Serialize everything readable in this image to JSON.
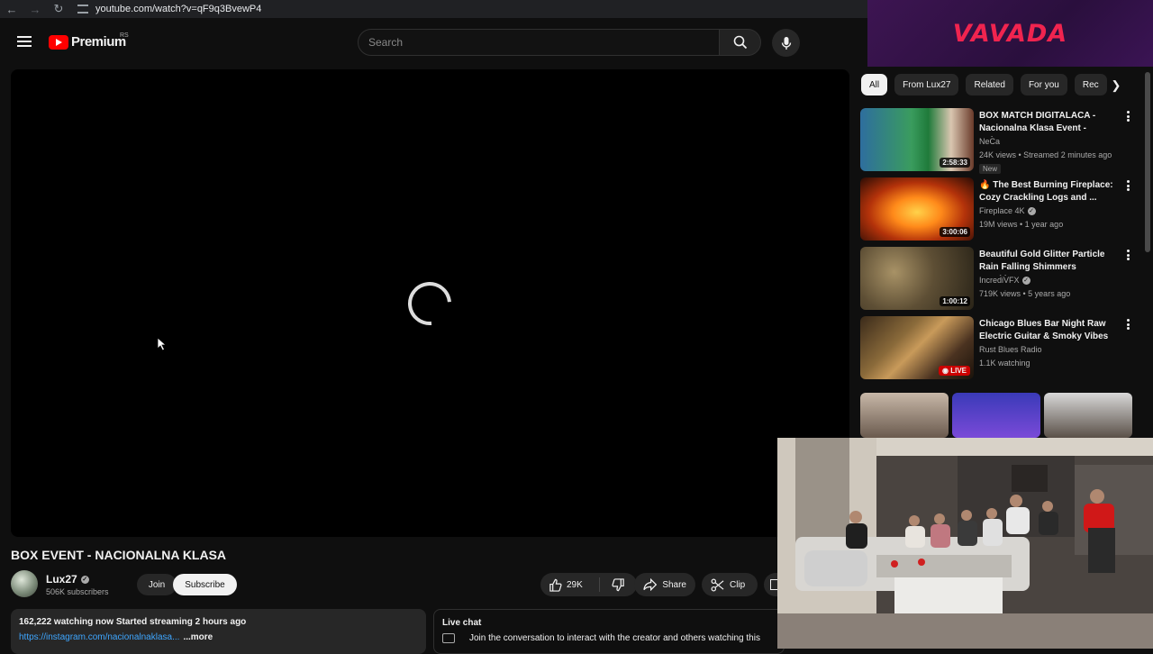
{
  "browser": {
    "url": "youtube.com/watch?v=qF9q3BvewP4"
  },
  "header": {
    "logo_text": "Premium",
    "country_code": "RS",
    "search_placeholder": "Search"
  },
  "video": {
    "title": "BOX EVENT - NACIONALNA KLASA"
  },
  "channel": {
    "name": "Lux27",
    "subscribers": "506K subscribers",
    "join_label": "Join",
    "subscribe_label": "Subscribe"
  },
  "actions": {
    "likes": "29K",
    "share_label": "Share",
    "clip_label": "Clip"
  },
  "description": {
    "stats": "162,222 watching now  Started streaming 2 hours ago",
    "link": "https://instagram.com/nacionalnaklasa...",
    "more_label": "...more"
  },
  "live_chat": {
    "title": "Live chat",
    "prompt": "Join the conversation to interact with the creator and others watching this"
  },
  "ad": {
    "brand": "VAVADA"
  },
  "chips": [
    "All",
    "From Lux27",
    "Related",
    "For you",
    "Rec"
  ],
  "recommendations": [
    {
      "title": "BOX MATCH DIGITALACA - Nacionalna Klasa Event - Baka...",
      "channel": "NeCa",
      "verified": false,
      "meta": "24K views • Streamed 2 minutes ago",
      "duration": "2:58:33",
      "badge": "New"
    },
    {
      "title": "🔥 The Best Burning Fireplace: Cozy Crackling Logs and ...",
      "channel": "Fireplace 4K",
      "verified": true,
      "meta": "19M views • 1 year ago",
      "duration": "3:00:06"
    },
    {
      "title": "Beautiful Gold Glitter Particle Rain Falling Shimmers Sparkle...",
      "channel": "IncrediVFX",
      "verified": true,
      "meta": "719K views • 5 years ago",
      "duration": "1:00:12"
    },
    {
      "title": "Chicago Blues Bar Night Raw Electric Guitar & Smoky Vibes",
      "channel": "Rust Blues Radio",
      "verified": false,
      "meta": "1.1K watching",
      "live_label": "LIVE"
    }
  ],
  "colors": {
    "accent": "#3ea6ff",
    "brand_red": "#ff0000",
    "ad_text": "#f0244f",
    "background": "#0f0f0f"
  }
}
